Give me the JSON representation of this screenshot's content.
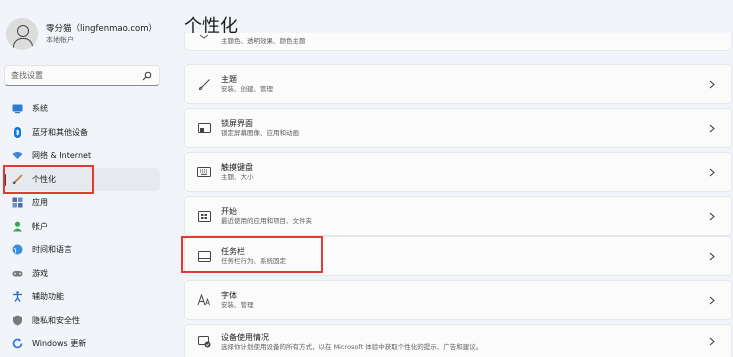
{
  "profile": {
    "name": "零分猫（lingfenmao.com）",
    "account_type": "本地帐户"
  },
  "search": {
    "placeholder": "查找设置"
  },
  "sidebar": {
    "items": [
      {
        "label": "系统",
        "icon": "monitor-icon",
        "color": "#2b7cd3"
      },
      {
        "label": "蓝牙和其他设备",
        "icon": "bluetooth-icon",
        "color": "#0a74d8"
      },
      {
        "label": "网络 & Internet",
        "icon": "wifi-icon",
        "color": "#3b87d6"
      },
      {
        "label": "个性化",
        "icon": "brush-icon",
        "color": "#c47a3a",
        "active": true
      },
      {
        "label": "应用",
        "icon": "apps-icon",
        "color": "#4a6fa5"
      },
      {
        "label": "帐户",
        "icon": "user-icon",
        "color": "#2eaa5a"
      },
      {
        "label": "时间和语言",
        "icon": "globe-icon",
        "color": "#3a8edb"
      },
      {
        "label": "游戏",
        "icon": "gamepad-icon",
        "color": "#6b6b6b"
      },
      {
        "label": "辅助功能",
        "icon": "accessibility-icon",
        "color": "#1e6fc7"
      },
      {
        "label": "隐私和安全性",
        "icon": "shield-icon",
        "color": "#6b6b6b"
      },
      {
        "label": "Windows 更新",
        "icon": "update-icon",
        "color": "#2a76d2"
      }
    ]
  },
  "main": {
    "title": "个性化",
    "cards": [
      {
        "title": "",
        "desc": "主题色、透明效果、颜色主题",
        "icon": "palette-icon"
      },
      {
        "title": "主题",
        "desc": "安装、创建、管理",
        "icon": "brush-icon"
      },
      {
        "title": "锁屏界面",
        "desc": "锁定屏幕图像、应用和动画",
        "icon": "lock-screen-icon"
      },
      {
        "title": "触摸键盘",
        "desc": "主题、大小",
        "icon": "keyboard-icon"
      },
      {
        "title": "开始",
        "desc": "最近使用的应用和项目、文件夹",
        "icon": "start-icon"
      },
      {
        "title": "任务栏",
        "desc": "任务栏行为、系统固定",
        "icon": "taskbar-icon"
      },
      {
        "title": "字体",
        "desc": "安装、管理",
        "icon": "font-icon"
      },
      {
        "title": "设备使用情况",
        "desc": "选择你计划使用设备的所有方式，以在 Microsoft 体验中获取个性化的提示、广告和建议。",
        "icon": "device-usage-icon"
      }
    ]
  },
  "colors": {
    "accent": "#0067c0",
    "highlight": "#e23b36",
    "background": "#f1f4f9"
  }
}
